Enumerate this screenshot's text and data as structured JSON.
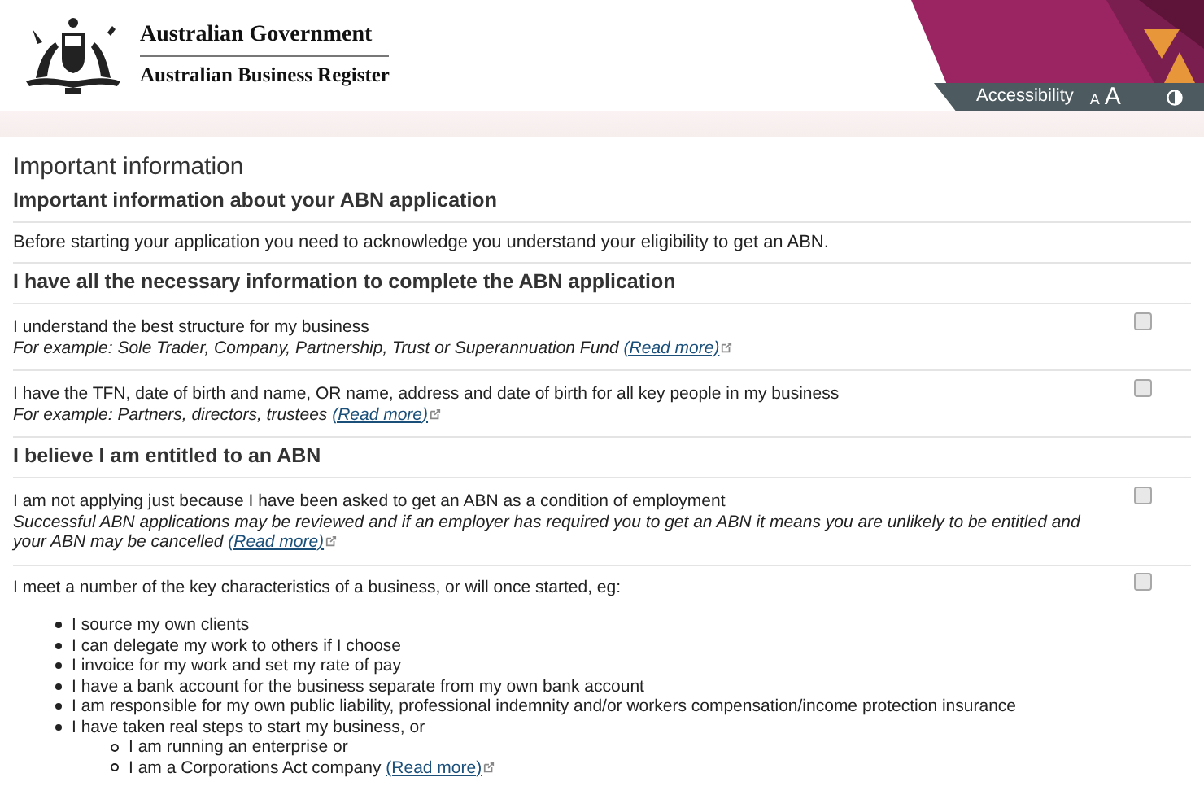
{
  "header": {
    "agency": "Australian Government",
    "register": "Australian Business Register",
    "accessibility": {
      "label": "Accessibility",
      "font_small": "A",
      "font_large": "A"
    }
  },
  "title": "Important information",
  "subtitle": "Important information about your ABN application",
  "intro": "Before starting your application you need to acknowledge you understand your eligibility to get an ABN.",
  "sections": [
    {
      "heading": "I have all the necessary information to complete the ABN application",
      "items": [
        {
          "label": "I understand the best structure for my business",
          "note": "For example: Sole Trader, Company, Partnership, Trust or Superannuation Fund",
          "link": "(Read more)",
          "checked": false
        },
        {
          "label": "I have the TFN, date of birth and name, OR name, address and date of birth for all key people in my business",
          "note": "For example: Partners, directors, trustees",
          "link": "(Read more)",
          "checked": false
        }
      ]
    },
    {
      "heading": "I believe I am entitled to an ABN",
      "items": [
        {
          "label": "I am not applying just because I have been asked to get an ABN as a condition of employment",
          "note": "Successful ABN applications may be reviewed and if an employer has required you to get an ABN it means you are unlikely to be entitled and your ABN may be cancelled",
          "link": "(Read more)",
          "checked": false
        },
        {
          "label": "I meet a number of the key characteristics of a business, or will once started, eg:",
          "checked": false,
          "bullets": [
            {
              "text": "I source my own clients"
            },
            {
              "text": "I can delegate my work to others if I choose"
            },
            {
              "text": "I invoice for my work and set my rate of pay"
            },
            {
              "text": "I have a bank account for the business separate from my own bank account"
            },
            {
              "text": "I am responsible for my own public liability, professional indemnity and/or workers compensation/income protection insurance"
            },
            {
              "text": "I have taken real steps to start my business, or",
              "children": [
                {
                  "text": "I am running an enterprise or"
                },
                {
                  "text": "I am a Corporations Act company",
                  "link": "(Read more)"
                }
              ]
            }
          ]
        }
      ]
    }
  ]
}
